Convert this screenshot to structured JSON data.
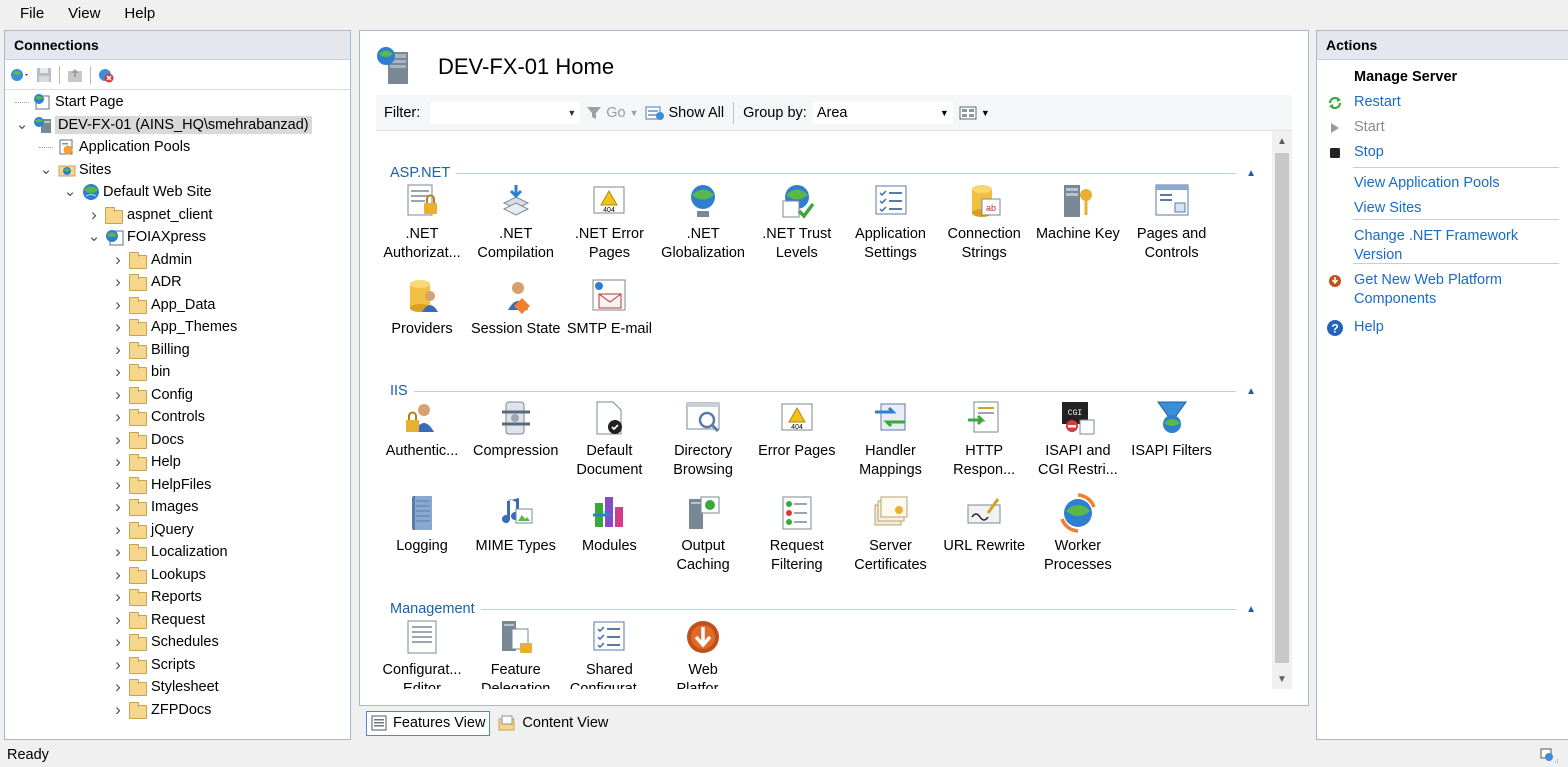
{
  "menu": [
    "File",
    "View",
    "Help"
  ],
  "connections": {
    "title": "Connections",
    "tree": [
      {
        "label": "Start Page",
        "level": 0,
        "icon": "start-page-icon",
        "expander": "none"
      },
      {
        "label": "DEV-FX-01 (AINS_HQ\\smehrabanzad)",
        "level": 0,
        "icon": "server-icon",
        "expander": "expanded",
        "selected": true
      },
      {
        "label": "Application Pools",
        "level": 1,
        "icon": "app-pools-icon",
        "expander": "none"
      },
      {
        "label": "Sites",
        "level": 1,
        "icon": "sites-icon",
        "expander": "expanded"
      },
      {
        "label": "Default Web Site",
        "level": 2,
        "icon": "website-icon",
        "expander": "expanded"
      },
      {
        "label": "aspnet_client",
        "level": 3,
        "icon": "folder-icon",
        "expander": "collapsed"
      },
      {
        "label": "FOIAXpress",
        "level": 3,
        "icon": "web-app-icon",
        "expander": "expanded"
      },
      {
        "label": "Admin",
        "level": 4,
        "icon": "folder-icon",
        "expander": "collapsed"
      },
      {
        "label": "ADR",
        "level": 4,
        "icon": "folder-icon",
        "expander": "collapsed"
      },
      {
        "label": "App_Data",
        "level": 4,
        "icon": "folder-icon",
        "expander": "collapsed"
      },
      {
        "label": "App_Themes",
        "level": 4,
        "icon": "folder-icon",
        "expander": "collapsed"
      },
      {
        "label": "Billing",
        "level": 4,
        "icon": "folder-icon",
        "expander": "collapsed"
      },
      {
        "label": "bin",
        "level": 4,
        "icon": "folder-icon",
        "expander": "collapsed"
      },
      {
        "label": "Config",
        "level": 4,
        "icon": "folder-icon",
        "expander": "collapsed"
      },
      {
        "label": "Controls",
        "level": 4,
        "icon": "folder-icon",
        "expander": "collapsed"
      },
      {
        "label": "Docs",
        "level": 4,
        "icon": "folder-icon",
        "expander": "collapsed"
      },
      {
        "label": "Help",
        "level": 4,
        "icon": "folder-icon",
        "expander": "collapsed"
      },
      {
        "label": "HelpFiles",
        "level": 4,
        "icon": "folder-icon",
        "expander": "collapsed"
      },
      {
        "label": "Images",
        "level": 4,
        "icon": "folder-icon",
        "expander": "collapsed"
      },
      {
        "label": "jQuery",
        "level": 4,
        "icon": "folder-icon",
        "expander": "collapsed"
      },
      {
        "label": "Localization",
        "level": 4,
        "icon": "folder-icon",
        "expander": "collapsed"
      },
      {
        "label": "Lookups",
        "level": 4,
        "icon": "folder-icon",
        "expander": "collapsed"
      },
      {
        "label": "Reports",
        "level": 4,
        "icon": "folder-icon",
        "expander": "collapsed"
      },
      {
        "label": "Request",
        "level": 4,
        "icon": "folder-icon",
        "expander": "collapsed"
      },
      {
        "label": "Schedules",
        "level": 4,
        "icon": "folder-icon",
        "expander": "collapsed"
      },
      {
        "label": "Scripts",
        "level": 4,
        "icon": "folder-icon",
        "expander": "collapsed"
      },
      {
        "label": "Stylesheet",
        "level": 4,
        "icon": "folder-icon",
        "expander": "collapsed"
      },
      {
        "label": "ZFPDocs",
        "level": 4,
        "icon": "folder-icon",
        "expander": "collapsed"
      }
    ]
  },
  "center": {
    "title": "DEV-FX-01 Home",
    "filter": {
      "label": "Filter:",
      "go_label": "Go",
      "show_all_label": "Show All",
      "group_by_label": "Group by:",
      "group_by_value": "Area"
    },
    "groups": [
      {
        "name": "ASP.NET",
        "features": [
          {
            "label": [
              ".NET",
              "Authorizat..."
            ],
            "icon": "net-authorization-icon"
          },
          {
            "label": [
              ".NET",
              "Compilation"
            ],
            "icon": "net-compilation-icon"
          },
          {
            "label": [
              ".NET Error",
              "Pages"
            ],
            "icon": "net-error-pages-icon"
          },
          {
            "label": [
              ".NET",
              "Globalization"
            ],
            "icon": "net-globalization-icon"
          },
          {
            "label": [
              ".NET Trust",
              "Levels"
            ],
            "icon": "net-trust-levels-icon"
          },
          {
            "label": [
              "Application",
              "Settings"
            ],
            "icon": "application-settings-icon"
          },
          {
            "label": [
              "Connection",
              "Strings"
            ],
            "icon": "connection-strings-icon"
          },
          {
            "label": [
              "Machine Key",
              ""
            ],
            "icon": "machine-key-icon"
          },
          {
            "label": [
              "Pages and",
              "Controls"
            ],
            "icon": "pages-and-controls-icon"
          },
          {
            "label": [
              "Providers",
              ""
            ],
            "icon": "providers-icon"
          },
          {
            "label": [
              "Session State",
              ""
            ],
            "icon": "session-state-icon"
          },
          {
            "label": [
              "SMTP E-mail",
              ""
            ],
            "icon": "smtp-email-icon"
          }
        ]
      },
      {
        "name": "IIS",
        "features": [
          {
            "label": [
              "Authentic...",
              ""
            ],
            "icon": "authentication-icon"
          },
          {
            "label": [
              "Compression",
              ""
            ],
            "icon": "compression-icon"
          },
          {
            "label": [
              "Default",
              "Document"
            ],
            "icon": "default-document-icon"
          },
          {
            "label": [
              "Directory",
              "Browsing"
            ],
            "icon": "directory-browsing-icon"
          },
          {
            "label": [
              "Error Pages",
              ""
            ],
            "icon": "error-pages-icon"
          },
          {
            "label": [
              "Handler",
              "Mappings"
            ],
            "icon": "handler-mappings-icon"
          },
          {
            "label": [
              "HTTP",
              "Respon..."
            ],
            "icon": "http-response-icon"
          },
          {
            "label": [
              "ISAPI and",
              "CGI Restri..."
            ],
            "icon": "isapi-cgi-icon"
          },
          {
            "label": [
              "ISAPI Filters",
              ""
            ],
            "icon": "isapi-filters-icon"
          },
          {
            "label": [
              "Logging",
              ""
            ],
            "icon": "logging-icon"
          },
          {
            "label": [
              "MIME Types",
              ""
            ],
            "icon": "mime-types-icon"
          },
          {
            "label": [
              "Modules",
              ""
            ],
            "icon": "modules-icon"
          },
          {
            "label": [
              "Output",
              "Caching"
            ],
            "icon": "output-caching-icon"
          },
          {
            "label": [
              "Request",
              "Filtering"
            ],
            "icon": "request-filtering-icon"
          },
          {
            "label": [
              "Server",
              "Certificates"
            ],
            "icon": "server-certificates-icon"
          },
          {
            "label": [
              "URL Rewrite",
              ""
            ],
            "icon": "url-rewrite-icon"
          },
          {
            "label": [
              "Worker",
              "Processes"
            ],
            "icon": "worker-processes-icon"
          }
        ]
      },
      {
        "name": "Management",
        "features": [
          {
            "label": [
              "Configurat...",
              "Editor"
            ],
            "icon": "configuration-editor-icon"
          },
          {
            "label": [
              "Feature",
              "Delegation"
            ],
            "icon": "feature-delegation-icon"
          },
          {
            "label": [
              "Shared",
              "Configurat..."
            ],
            "icon": "shared-configuration-icon"
          },
          {
            "label": [
              "Web",
              "Platfor..."
            ],
            "icon": "web-platform-icon"
          }
        ]
      }
    ],
    "tabs": [
      {
        "label": "Features View",
        "active": true
      },
      {
        "label": "Content View",
        "active": false
      }
    ]
  },
  "actions": {
    "title": "Actions",
    "section_title": "Manage Server",
    "items": [
      {
        "label": "Restart",
        "icon": "restart-icon",
        "enabled": true
      },
      {
        "label": "Start",
        "icon": "start-icon",
        "enabled": false
      },
      {
        "label": "Stop",
        "icon": "stop-icon",
        "enabled": true
      },
      {
        "label": "View Application Pools",
        "icon": "",
        "enabled": true
      },
      {
        "label": "View Sites",
        "icon": "",
        "enabled": true
      },
      {
        "label": "Change .NET Framework Version",
        "icon": "",
        "enabled": true
      },
      {
        "label": "Get New Web Platform Components",
        "icon": "web-platform-small-icon",
        "enabled": true
      },
      {
        "label": "Help",
        "icon": "help-icon",
        "enabled": true
      }
    ]
  },
  "status": {
    "text": "Ready"
  },
  "colors": {
    "link": "#1a6bc4",
    "group_header": "#1a5fa8",
    "pane_border": "#a8b8cc"
  }
}
